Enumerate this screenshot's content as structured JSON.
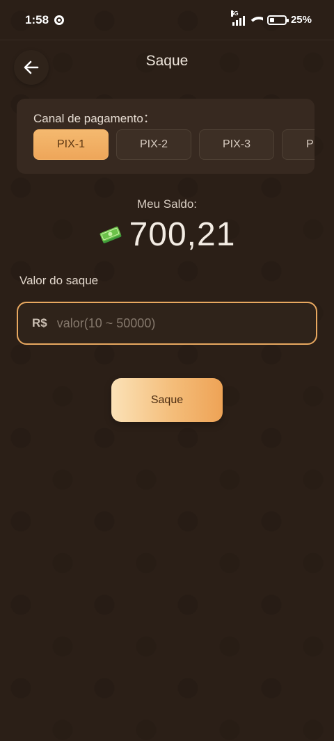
{
  "status_bar": {
    "time": "1:58",
    "network_label": "5G",
    "battery": "25%"
  },
  "header": {
    "title": "Saque"
  },
  "payment_channel": {
    "label": "Canal de pagamento：",
    "options": [
      "PIX-1",
      "PIX-2",
      "PIX-3",
      "P"
    ],
    "selected": "PIX-1"
  },
  "balance": {
    "label": "Meu Saldo:",
    "value": "700,21",
    "icon": "money-bill-icon"
  },
  "withdraw": {
    "label": "Valor do saque",
    "currency": "R$",
    "value": "",
    "placeholder": "valor(10 ~ 50000)"
  },
  "submit": {
    "label": "Saque"
  },
  "colors": {
    "background": "#2b1f17",
    "accent": "#eea65a",
    "input_border": "#e8a860"
  }
}
